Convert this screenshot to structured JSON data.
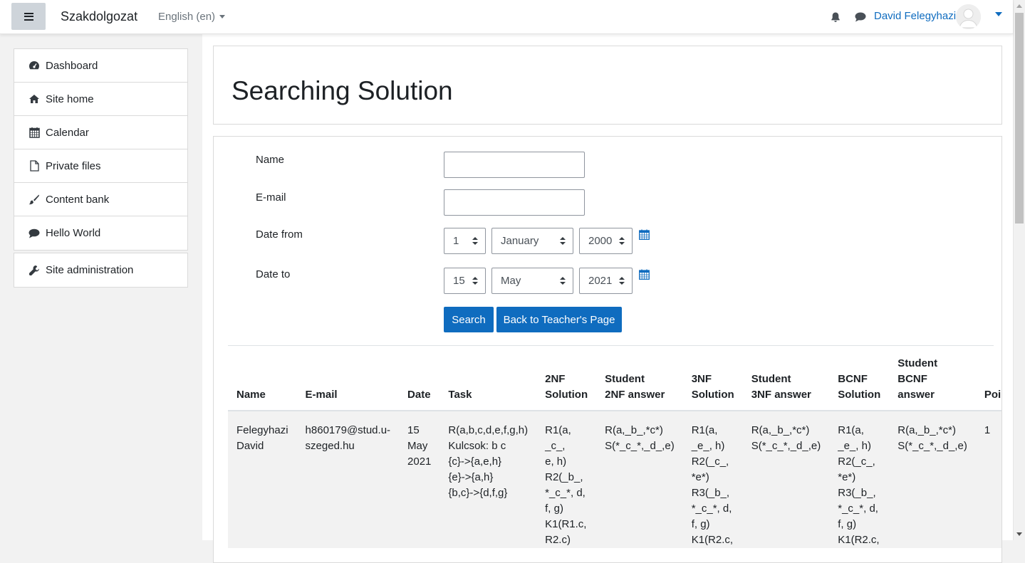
{
  "navbar": {
    "brand": "Szakdolgozat",
    "language": "English (en)",
    "user_name": "David Felegyhazi"
  },
  "sidebar": {
    "items": [
      {
        "label": "Dashboard",
        "icon": "dashboard-icon"
      },
      {
        "label": "Site home",
        "icon": "home-icon"
      },
      {
        "label": "Calendar",
        "icon": "calendar-icon"
      },
      {
        "label": "Private files",
        "icon": "file-icon"
      },
      {
        "label": "Content bank",
        "icon": "brush-icon"
      },
      {
        "label": "Hello World",
        "icon": "comment-icon"
      }
    ],
    "admin": {
      "label": "Site administration",
      "icon": "wrench-icon"
    }
  },
  "page": {
    "title": "Searching Solution"
  },
  "form": {
    "name_label": "Name",
    "name_value": "",
    "email_label": "E-mail",
    "email_value": "",
    "date_from_label": "Date from",
    "date_from": {
      "day": "1",
      "month": "January",
      "year": "2000"
    },
    "date_to_label": "Date to",
    "date_to": {
      "day": "15",
      "month": "May",
      "year": "2021"
    },
    "search_button": "Search",
    "back_button": "Back to Teacher's Page"
  },
  "table": {
    "headers": [
      "Name",
      "E-mail",
      "Date",
      "Task",
      "2NF\nSolution",
      "Student\n2NF answer",
      "3NF\nSolution",
      "Student\n3NF answer",
      "BCNF\nSolution",
      "Student\nBCNF\nanswer",
      "Points"
    ],
    "rows": [
      {
        "name": "Felegyhazi\nDavid",
        "email": "h860179@stud.u-\nszeged.hu",
        "date": "15\nMay\n2021",
        "task": "R(a,b,c,d,e,f,g,h)\nKulcsok: b c\n{c}->{a,e,h}\n{e}->{a,h}\n{b,c}->{d,f,g}",
        "nf2_solution": "R1(a, _c_,\ne, h)\nR2(_b_,\n*_c_*, d,\nf, g)\nK1(R1.c,\nR2.c)",
        "nf2_answer": "R(a,_b_,*c*)\nS(*_c_*,_d_,e)",
        "nf3_solution": "R1(a,\n_e_, h)\nR2(_c_,\n*e*)\nR3(_b_,\n*_c_*, d,\nf, g)\nK1(R2.c,",
        "nf3_answer": "R(a,_b_,*c*)\nS(*_c_*,_d_,e)",
        "bcnf_solution": "R1(a,\n_e_, h)\nR2(_c_,\n*e*)\nR3(_b_,\n*_c_*, d,\nf, g)\nK1(R2.c,",
        "bcnf_answer": "R(a,_b_,*c*)\nS(*_c_*,_d_,e)",
        "points": "1"
      }
    ]
  }
}
